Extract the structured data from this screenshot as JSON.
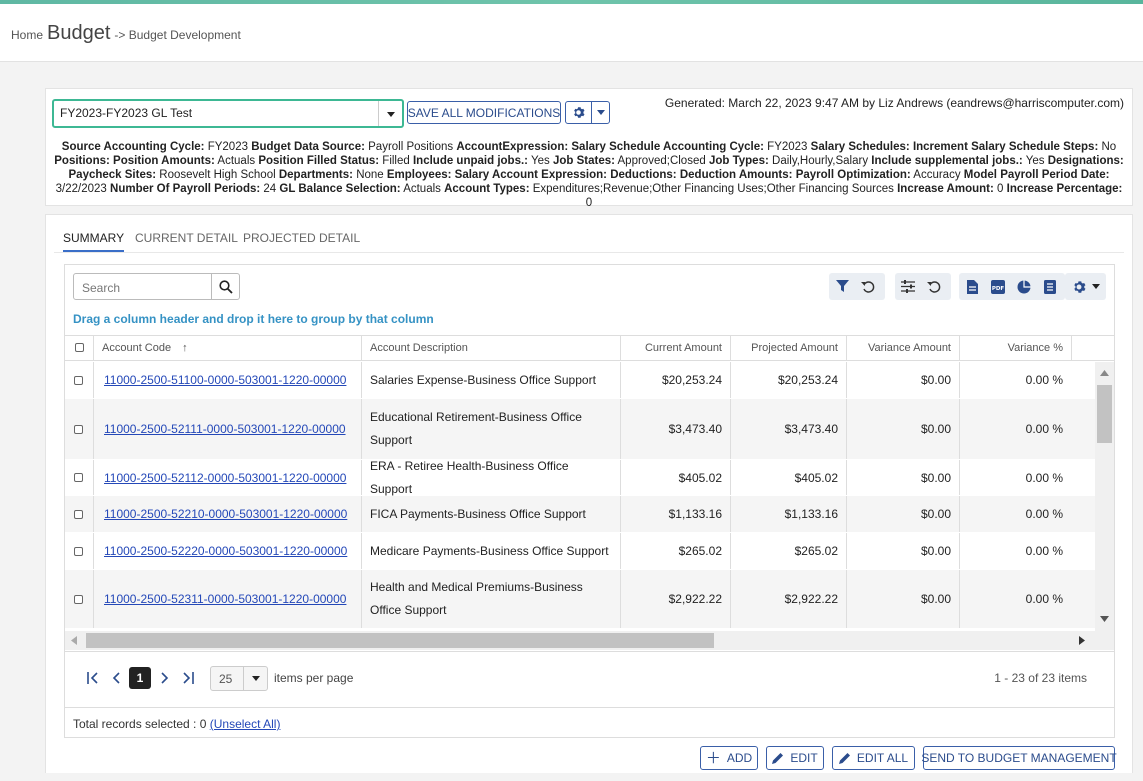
{
  "breadcrumb": {
    "home": "Home",
    "module": "Budget",
    "page": "-> Budget Development"
  },
  "budget_select": {
    "value": "FY2023-FY2023 GL Test"
  },
  "toolbar": {
    "save_all": "SAVE ALL MODIFICATIONS"
  },
  "generated": "Generated: March 22, 2023 9:47 AM by Liz Andrews (eandrews@harriscomputer.com)",
  "params": [
    {
      "k": "Source Accounting Cycle:",
      "v": "FY2023"
    },
    {
      "k": "Budget Data Source:",
      "v": "Payroll Positions"
    },
    {
      "k": "AccountExpression:",
      "v": ""
    },
    {
      "k": "Salary Schedule Accounting Cycle:",
      "v": "FY2023"
    },
    {
      "k": "Salary Schedules:",
      "v": ""
    },
    {
      "k": "Increment Salary Schedule Steps:",
      "v": "No"
    },
    {
      "k": "Positions:",
      "v": ""
    },
    {
      "k": "Position Amounts:",
      "v": "Actuals"
    },
    {
      "k": "Position Filled Status:",
      "v": "Filled"
    },
    {
      "k": "Include unpaid jobs.:",
      "v": "Yes"
    },
    {
      "k": "Job States:",
      "v": "Approved;Closed"
    },
    {
      "k": "Job Types:",
      "v": "Daily,Hourly,Salary"
    },
    {
      "k": "Include supplemental jobs.:",
      "v": "Yes"
    },
    {
      "k": "Designations:",
      "v": ""
    },
    {
      "k": "Paycheck Sites:",
      "v": "Roosevelt High School"
    },
    {
      "k": "Departments:",
      "v": "None"
    },
    {
      "k": "Employees:",
      "v": ""
    },
    {
      "k": "Salary Account Expression:",
      "v": ""
    },
    {
      "k": "Deductions:",
      "v": ""
    },
    {
      "k": "Deduction Amounts:",
      "v": ""
    },
    {
      "k": "Payroll Optimization:",
      "v": "Accuracy"
    },
    {
      "k": "Model Payroll Period Date:",
      "v": "3/22/2023"
    },
    {
      "k": "Number Of Payroll Periods:",
      "v": "24"
    },
    {
      "k": "GL Balance Selection:",
      "v": "Actuals"
    },
    {
      "k": "Account Types:",
      "v": "Expenditures;Revenue;Other Financing Uses;Other Financing Sources"
    },
    {
      "k": "Increase Amount:",
      "v": "0"
    },
    {
      "k": "Increase Percentage:",
      "v": "0"
    }
  ],
  "tabs": [
    "SUMMARY",
    "CURRENT DETAIL",
    "PROJECTED DETAIL"
  ],
  "grid": {
    "search_placeholder": "Search",
    "group_hint": "Drag a column header and drop it here to group by that column",
    "columns": [
      "Account Code",
      "Account Description",
      "Current Amount",
      "Projected Amount",
      "Variance Amount",
      "Variance %"
    ],
    "sort_indicator": "↑",
    "rows": [
      {
        "code": "11000-2500-51100-0000-503001-1220-00000",
        "desc": "Salaries Expense-Business Office Support",
        "cur": "$20,253.24",
        "proj": "$20,253.24",
        "var": "$0.00",
        "pct": "0.00 %"
      },
      {
        "code": "11000-2500-52111-0000-503001-1220-00000",
        "desc": "Educational Retirement-Business Office Support",
        "cur": "$3,473.40",
        "proj": "$3,473.40",
        "var": "$0.00",
        "pct": "0.00 %"
      },
      {
        "code": "11000-2500-52112-0000-503001-1220-00000",
        "desc": "ERA - Retiree Health-Business Office Support",
        "cur": "$405.02",
        "proj": "$405.02",
        "var": "$0.00",
        "pct": "0.00 %"
      },
      {
        "code": "11000-2500-52210-0000-503001-1220-00000",
        "desc": "FICA Payments-Business Office Support",
        "cur": "$1,133.16",
        "proj": "$1,133.16",
        "var": "$0.00",
        "pct": "0.00 %"
      },
      {
        "code": "11000-2500-52220-0000-503001-1220-00000",
        "desc": "Medicare Payments-Business Office Support",
        "cur": "$265.02",
        "proj": "$265.02",
        "var": "$0.00",
        "pct": "0.00 %"
      },
      {
        "code": "11000-2500-52311-0000-503001-1220-00000",
        "desc": "Health and Medical Premiums-Business Office Support",
        "cur": "$2,922.22",
        "proj": "$2,922.22",
        "var": "$0.00",
        "pct": "0.00 %"
      }
    ]
  },
  "pager": {
    "current": "1",
    "page_size": "25",
    "per_page_label": "items per page",
    "summary": "1 - 23 of 23 items"
  },
  "selection": {
    "label": "Total records selected : 0",
    "unselect": "(Unselect All)"
  },
  "actions": {
    "add": "ADD",
    "edit": "EDIT",
    "edit_all": "EDIT ALL",
    "send": "SEND TO BUDGET MANAGEMENT"
  },
  "colors": {
    "accent": "#3a5fa8",
    "link": "#2448b8",
    "hint": "#3592c4",
    "focus": "#3db894"
  }
}
